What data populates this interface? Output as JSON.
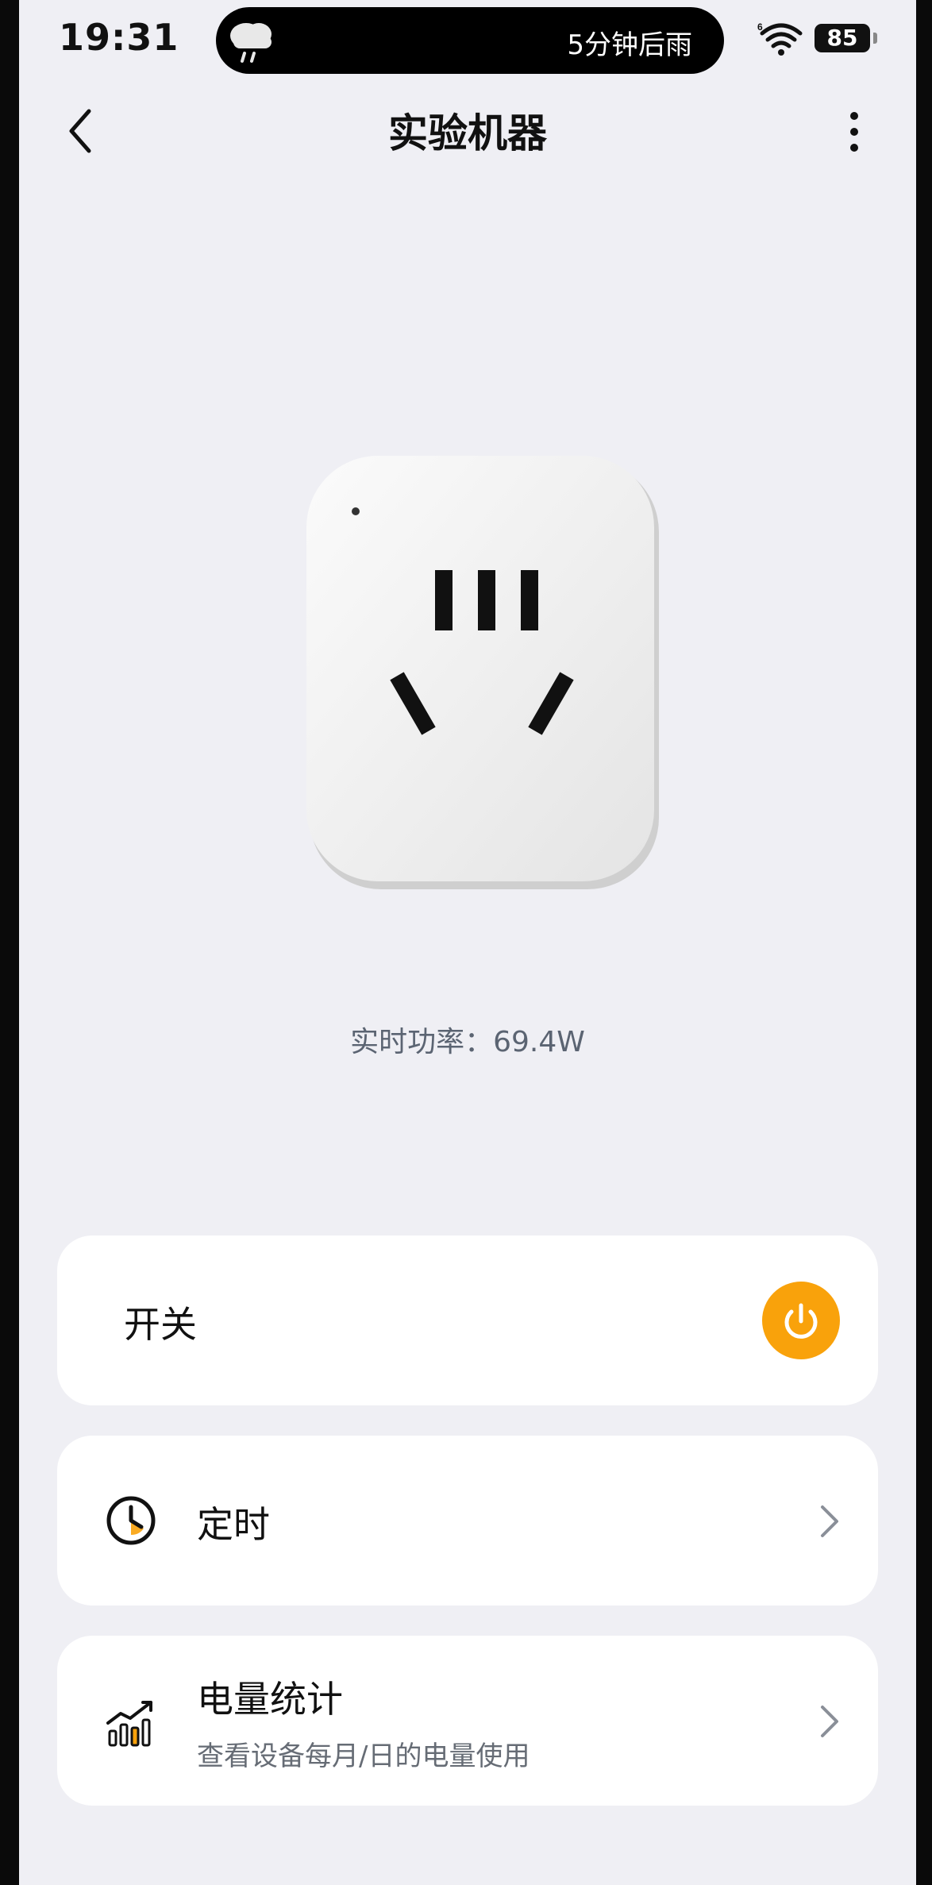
{
  "status_bar": {
    "time": "19:31",
    "island_text": "5分钟后雨",
    "battery": "85",
    "weather_icon": "cloud-rain-icon",
    "wifi_icon": "wifi-6-icon"
  },
  "header": {
    "title": "实验机器",
    "back_icon": "chevron-left-icon",
    "more_icon": "more-vertical-icon"
  },
  "device": {
    "realtime_power": "实时功率：69.4W"
  },
  "cards": {
    "switch": {
      "label": "开关",
      "accent": "#f9a20b",
      "icon": "power-icon"
    },
    "timer": {
      "label": "定时",
      "icon": "clock-icon"
    },
    "energy": {
      "label": "电量统计",
      "subtitle": "查看设备每月/日的电量使用",
      "icon": "bar-chart-icon"
    }
  }
}
